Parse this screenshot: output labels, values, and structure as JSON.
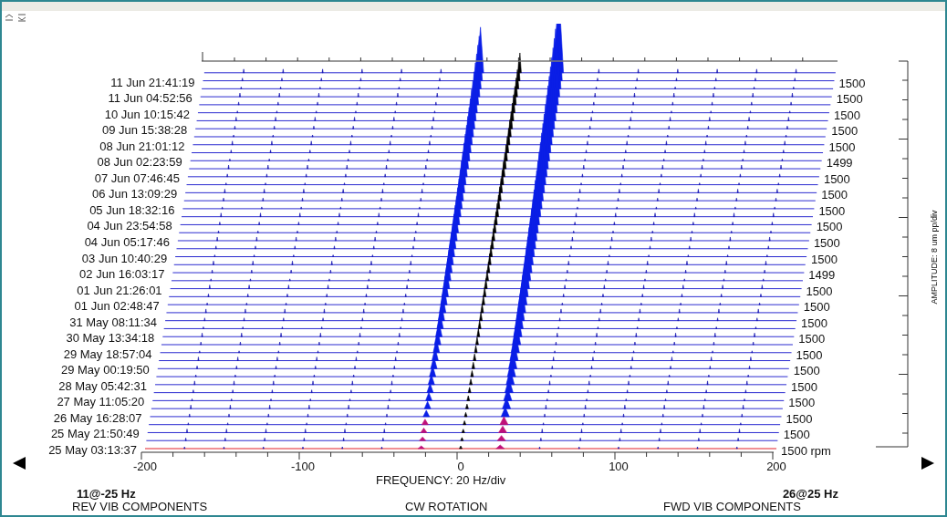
{
  "plot": {
    "timestamps": [
      "11 Jun 21:41:19",
      "11 Jun 04:52:56",
      "10 Jun 10:15:42",
      "09 Jun 15:38:28",
      "08 Jun 21:01:12",
      "08 Jun 02:23:59",
      "07 Jun 07:46:45",
      "06 Jun 13:09:29",
      "05 Jun 18:32:16",
      "04 Jun 23:54:58",
      "04 Jun 05:17:46",
      "03 Jun 10:40:29",
      "02 Jun 16:03:17",
      "01 Jun 21:26:01",
      "01 Jun 02:48:47",
      "31 May 08:11:34",
      "30 May 13:34:18",
      "29 May 18:57:04",
      "29 May 00:19:50",
      "28 May 05:42:31",
      "27 May 11:05:20",
      "26 May 16:28:07",
      "25 May 21:50:49",
      "25 May 03:13:37"
    ],
    "speeds": [
      "1500",
      "1500",
      "1500",
      "1500",
      "1500",
      "1499",
      "1500",
      "1500",
      "1500",
      "1500",
      "1500",
      "1500",
      "1499",
      "1500",
      "1500",
      "1500",
      "1500",
      "1500",
      "1500",
      "1500",
      "1500",
      "1500",
      "1500",
      "1500 rpm"
    ],
    "x_ticks": [
      "-200",
      "-100",
      "0",
      "100",
      "200"
    ],
    "x_label": "FREQUENCY: 20 Hz/div",
    "amplitude_label": "AMPLITUDE: 8 um pp/div"
  },
  "footer": {
    "left_marker": {
      "value": "11@-25 Hz",
      "caption": "REV VIB COMPONENTS"
    },
    "center_caption": "CW ROTATION",
    "right_marker": {
      "value": "26@25 Hz",
      "caption": "FWD VIB COMPONENTS"
    }
  }
}
